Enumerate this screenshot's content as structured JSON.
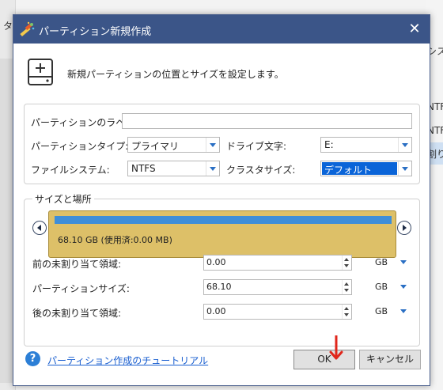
{
  "background": {
    "left_tab_char": "タ",
    "right_texts": [
      "シス",
      "NTF",
      "NTF",
      "割り"
    ]
  },
  "dialog": {
    "title": "パーティション新規作成",
    "header_text": "新規パーティションの位置とサイズを設定します。",
    "fields": {
      "label_label": "パーティションのラベル:",
      "label_value": "",
      "type_label": "パーティションタイプ:",
      "type_value": "プライマリ",
      "drive_label": "ドライブ文字:",
      "drive_value": "E:",
      "fs_label": "ファイルシステム:",
      "fs_value": "NTFS",
      "cluster_label": "クラスタサイズ:",
      "cluster_value": "デフォルト"
    },
    "size_group": {
      "title": "サイズと場所",
      "partition_label": "68.10 GB (使用済:0.00 MB)",
      "usage_fraction": 0.0
    },
    "spins": [
      {
        "label": "前の未割り当て領域:",
        "value": "0.00",
        "unit": "GB"
      },
      {
        "label": "パーティションサイズ:",
        "value": "68.10",
        "unit": "GB"
      },
      {
        "label": "後の未割り当て領域:",
        "value": "0.00",
        "unit": "GB"
      }
    ],
    "help_link": "パーティション作成のチュートリアル",
    "ok_label": "OK",
    "cancel_label": "キャンセル"
  },
  "colors": {
    "titlebar": "#3b5588",
    "partition_bar": "#ddc068",
    "usage_bar": "#3e8ed8",
    "link": "#1a5fd0",
    "annotation_arrow": "#e0261b"
  },
  "icons": [
    "wand-logo-icon",
    "close-icon",
    "disk-add-icon",
    "chevron-left-icon",
    "chevron-right-icon",
    "help-icon",
    "red-arrow-icon"
  ]
}
